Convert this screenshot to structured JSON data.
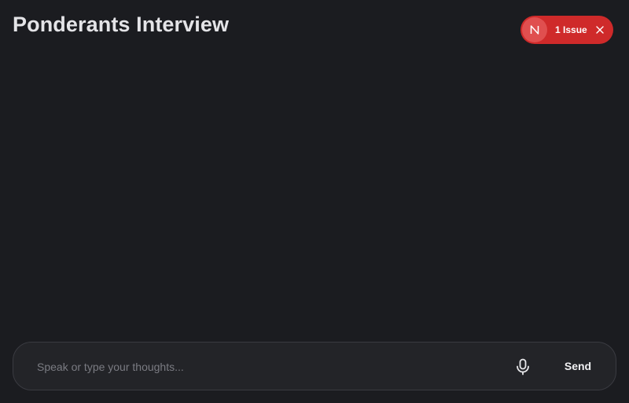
{
  "header": {
    "title": "Ponderants Interview"
  },
  "issue_badge": {
    "logo_letter": "N",
    "label": "1 Issue",
    "icons": {
      "logo": "n-logo-icon",
      "close": "close-icon"
    },
    "colors": {
      "background": "#cf2a2a",
      "logo_background": "#e04f4f"
    }
  },
  "composer": {
    "input_placeholder": "Speak or type your thoughts...",
    "input_value": "",
    "mic_icon": "microphone-icon",
    "send_label": "Send"
  },
  "theme": {
    "background": "#1b1c20",
    "composer_background": "#232428",
    "composer_border": "#3a3b41"
  }
}
